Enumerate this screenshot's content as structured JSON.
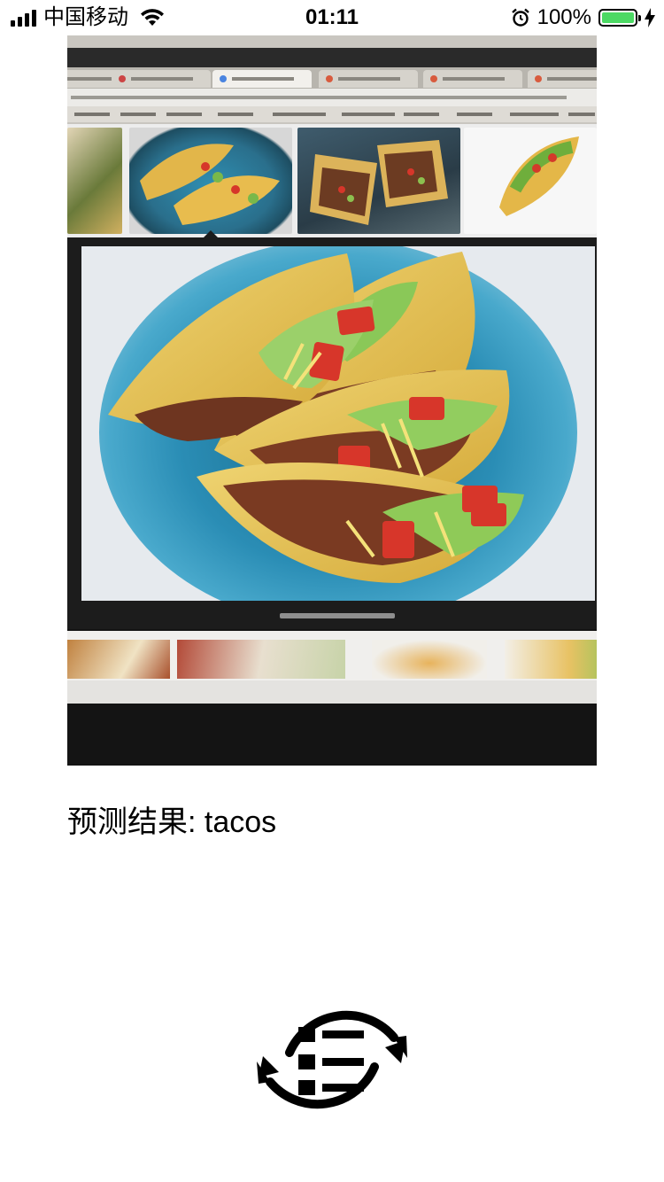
{
  "status_bar": {
    "carrier": "中国移动",
    "time": "01:11",
    "battery_percent": "100%",
    "battery_level": 1.0,
    "icons": [
      "signal-icon",
      "wifi-icon",
      "alarm-icon",
      "battery-icon",
      "charging-icon"
    ]
  },
  "photo": {
    "description_icon": "captured-photo",
    "subject": "tacos on a blue plate shown in a browser image search"
  },
  "result": {
    "label": "预测结果:",
    "value": "tacos"
  },
  "actions": {
    "refresh_icon": "refresh-list-icon"
  },
  "colors": {
    "battery_fill": "#4cd964",
    "text": "#000000",
    "background": "#ffffff"
  }
}
